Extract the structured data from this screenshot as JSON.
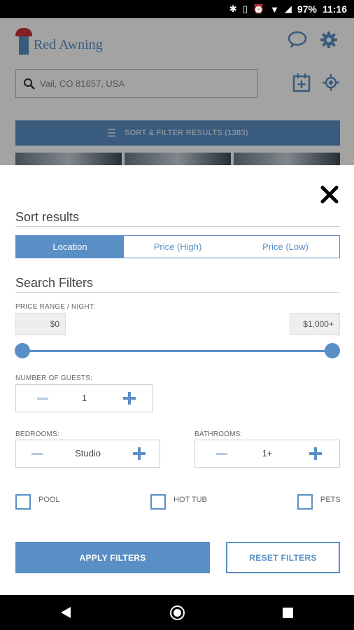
{
  "status_bar": {
    "battery": "97%",
    "time": "11:16"
  },
  "app": {
    "logo_text": "Red Awning"
  },
  "search": {
    "value": "Vail, CO 81657, USA"
  },
  "sort_filter_button": {
    "label": "SORT & FILTER RESULTS (1383)"
  },
  "sort": {
    "title": "Sort results",
    "options": [
      "Location",
      "Price (High)",
      "Price (Low)"
    ],
    "selected": "Location"
  },
  "filters": {
    "title": "Search Filters",
    "price_label": "PRICE RANGE / NIGHT:",
    "price_min": "$0",
    "price_max": "$1,000+",
    "guests_label": "NUMBER OF GUESTS:",
    "guests_value": "1",
    "bedrooms_label": "BEDROOMS:",
    "bedrooms_value": "Studio",
    "bathrooms_label": "BATHROOMS:",
    "bathrooms_value": "1+",
    "amenities": [
      "POOL",
      "HOT TUB",
      "PETS"
    ]
  },
  "buttons": {
    "apply": "APPLY FILTERS",
    "reset": "RESET FILTERS"
  },
  "colors": {
    "accent": "#5a8fc6",
    "logo_red": "#c8323a"
  }
}
